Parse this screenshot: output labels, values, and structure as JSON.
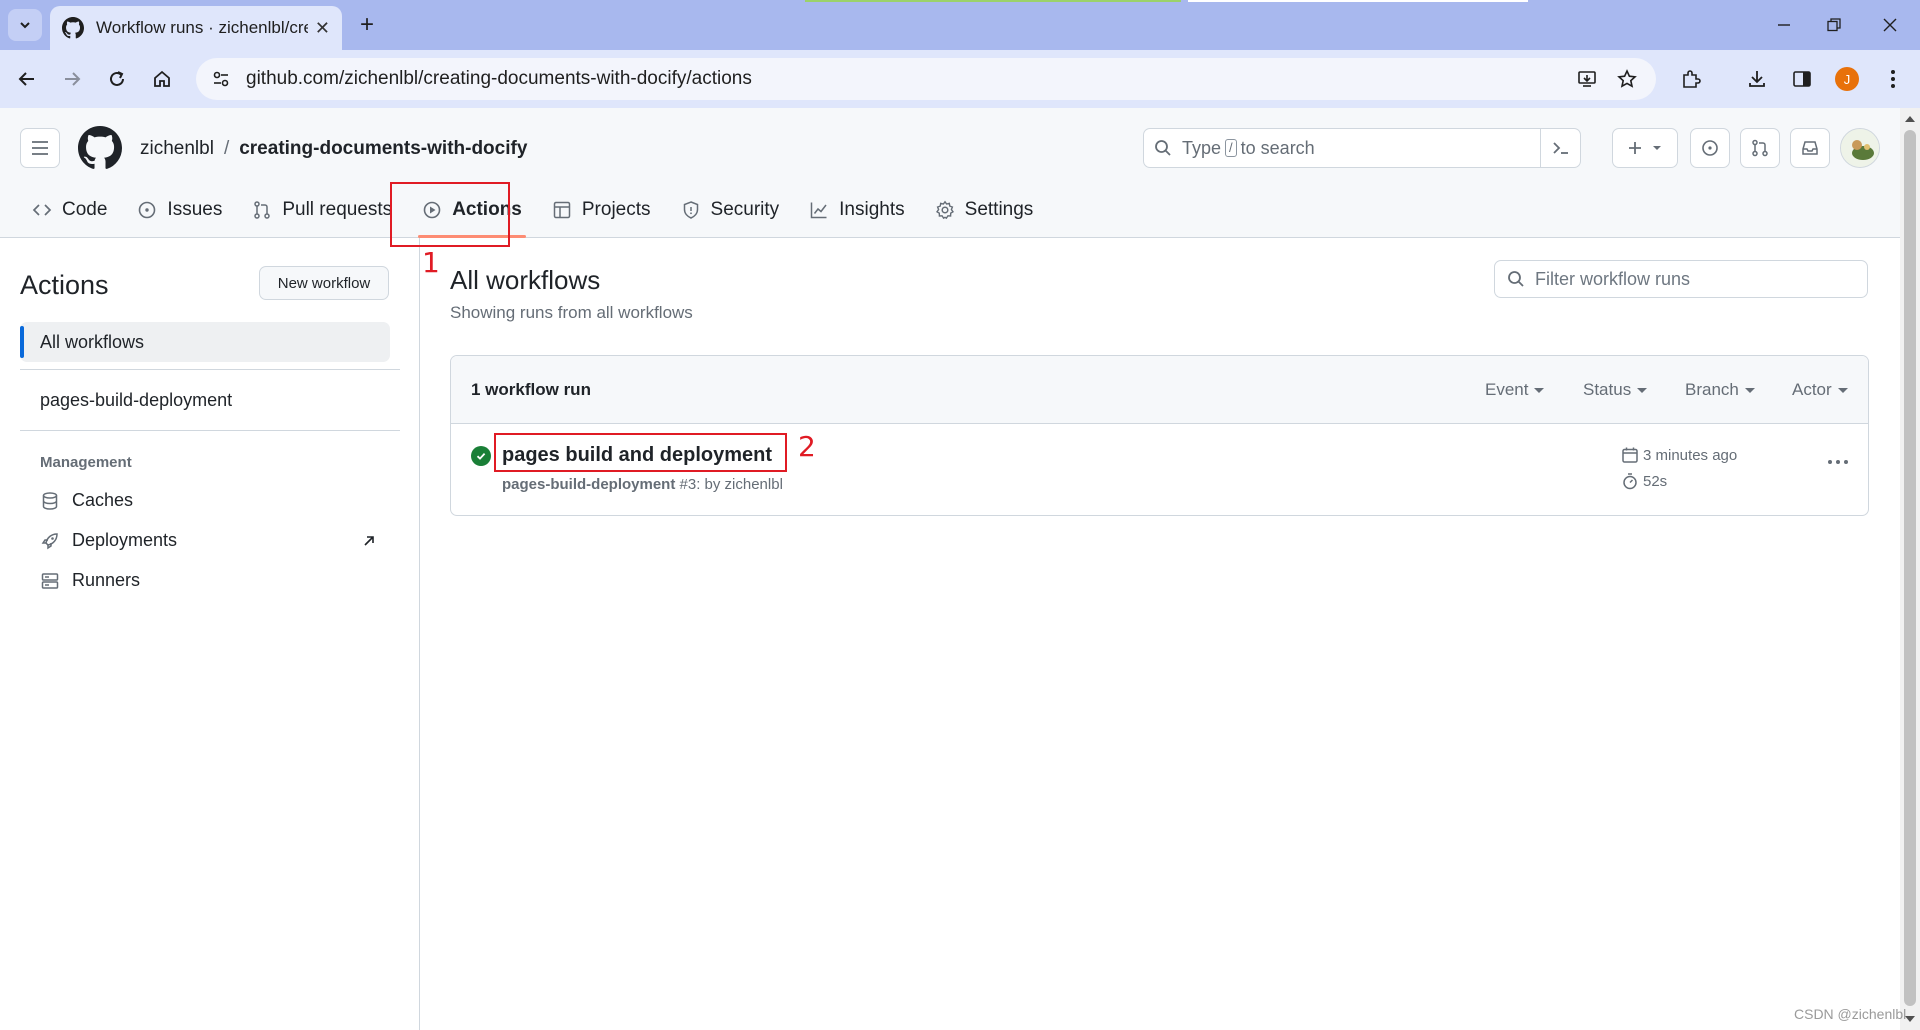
{
  "browser": {
    "tab_title": "Workflow runs · zichenlbl/creating-documents-with-docify",
    "url": "github.com/zichenlbl/creating-documents-with-docify/actions",
    "profile_initial": "J"
  },
  "header": {
    "owner": "zichenlbl",
    "separator": "/",
    "repo": "creating-documents-with-docify",
    "search_prefix": "Type",
    "search_slash": "/",
    "search_suffix": "to search"
  },
  "repo_nav": [
    {
      "label": "Code"
    },
    {
      "label": "Issues"
    },
    {
      "label": "Pull requests"
    },
    {
      "label": "Actions",
      "selected": true
    },
    {
      "label": "Projects"
    },
    {
      "label": "Security"
    },
    {
      "label": "Insights"
    },
    {
      "label": "Settings"
    }
  ],
  "sidebar": {
    "title": "Actions",
    "new_workflow": "New workflow",
    "all_workflows": "All workflows",
    "workflows": [
      "pages-build-deployment"
    ],
    "management_heading": "Management",
    "management_links": [
      "Caches",
      "Deployments",
      "Runners"
    ]
  },
  "main": {
    "title": "All workflows",
    "subtitle": "Showing runs from all workflows",
    "filter_placeholder": "Filter workflow runs",
    "run_count": "1 workflow run",
    "filters": [
      "Event",
      "Status",
      "Branch",
      "Actor"
    ],
    "runs": [
      {
        "title": "pages build and deployment",
        "workflow": "pages-build-deployment",
        "meta": " #3: by zichenlbl",
        "time": "3 minutes ago",
        "duration": "52s",
        "status": "success"
      }
    ]
  },
  "annotations": [
    "1",
    "2"
  ],
  "watermark": "CSDN @zichenlbl",
  "colors": {
    "accent": "#0969da",
    "success": "#1a7f37",
    "annotation": "#e01b24",
    "selected_underline": "#fd8c73"
  }
}
